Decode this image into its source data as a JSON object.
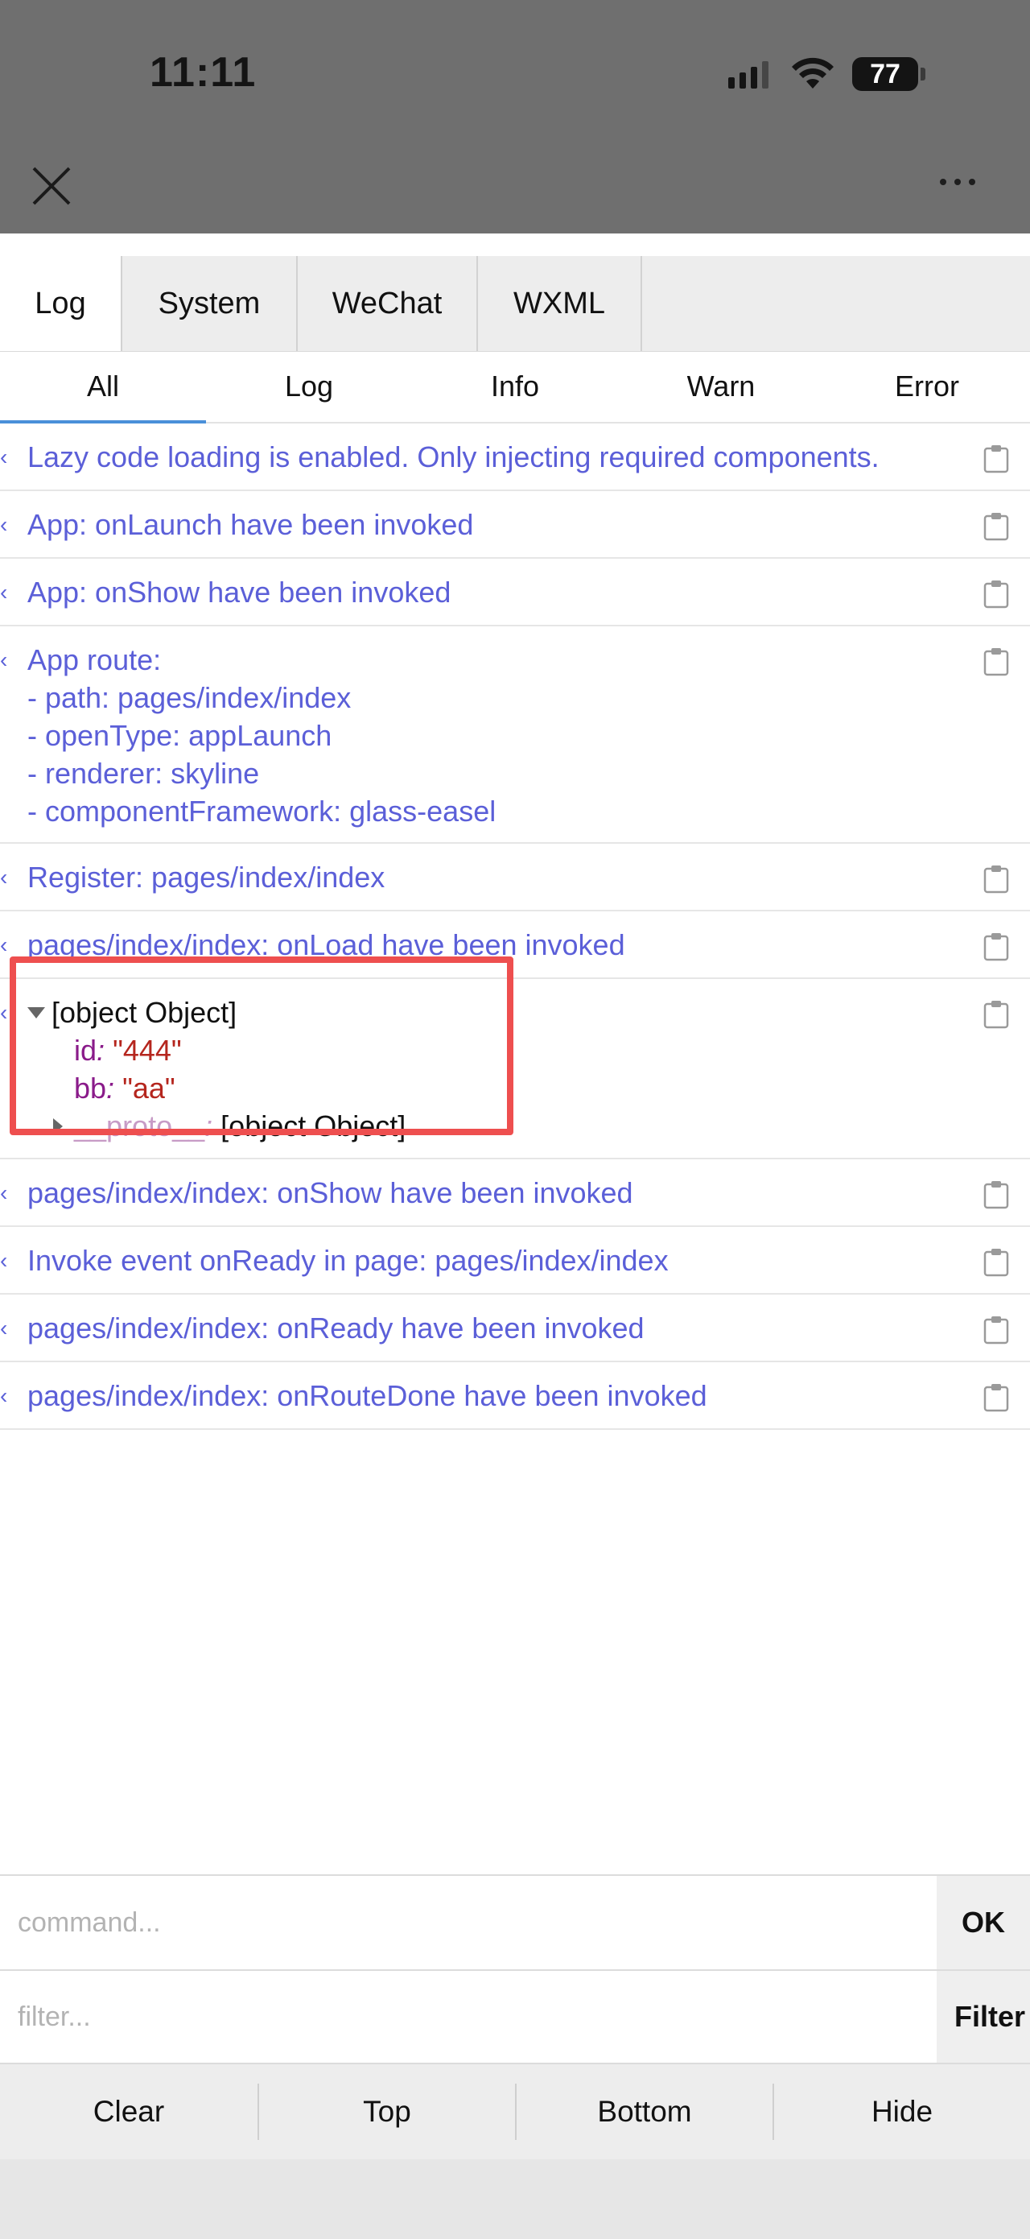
{
  "status_bar": {
    "time": "11:11",
    "battery": "77"
  },
  "top_bar": {
    "close_icon": "close-icon",
    "more_icon": "more-dots-icon"
  },
  "tabs": [
    {
      "label": "Log",
      "active": true
    },
    {
      "label": "System",
      "active": false
    },
    {
      "label": "WeChat",
      "active": false
    },
    {
      "label": "WXML",
      "active": false
    }
  ],
  "filter_tabs": [
    {
      "label": "All",
      "active": true
    },
    {
      "label": "Log",
      "active": false
    },
    {
      "label": "Info",
      "active": false
    },
    {
      "label": "Warn",
      "active": false
    },
    {
      "label": "Error",
      "active": false
    }
  ],
  "logs": [
    "Lazy code loading is enabled. Only injecting required components.",
    "App: onLaunch have been invoked",
    "App: onShow have been invoked",
    "App route:\n- path: pages/index/index\n- openType: appLaunch\n- renderer: skyline\n- componentFramework: glass-easel",
    "Register: pages/index/index",
    "pages/index/index: onLoad have been invoked",
    "pages/index/index: onShow have been invoked",
    "Invoke event onReady in page: pages/index/index",
    "pages/index/index: onReady have been invoked",
    "pages/index/index: onRouteDone have been invoked"
  ],
  "object_entry": {
    "summary": "[object Object]",
    "props": [
      {
        "key": "id",
        "value": "\"444\""
      },
      {
        "key": "bb",
        "value": "\"aa\""
      }
    ],
    "proto_key": "__proto__",
    "proto_value": "[object Object]"
  },
  "command": {
    "placeholder": "command...",
    "button": "OK"
  },
  "filter": {
    "placeholder": "filter...",
    "button": "Filter"
  },
  "toolbar": {
    "clear": "Clear",
    "top": "Top",
    "bottom": "Bottom",
    "hide": "Hide"
  },
  "colors": {
    "log_text": "#5b5fd8",
    "highlight": "#ee4f4f",
    "active_underline": "#4a90d9"
  }
}
